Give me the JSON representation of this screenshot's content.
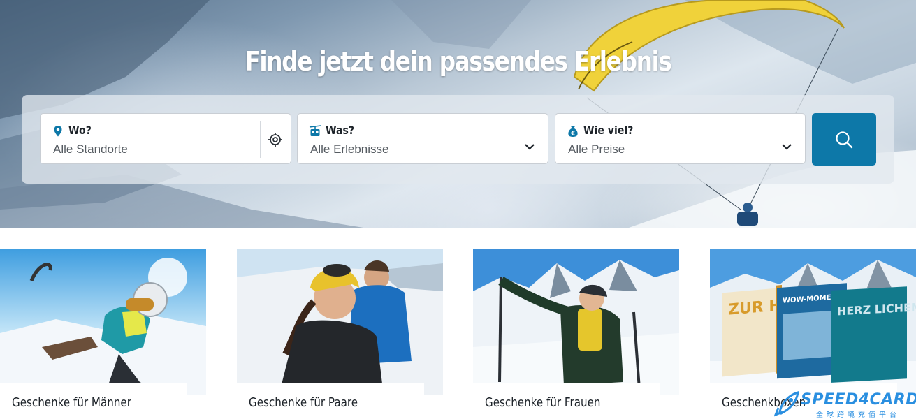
{
  "hero": {
    "title": "Finde jetzt dein passendes Erlebnis"
  },
  "search": {
    "location": {
      "label": "Wo?",
      "value": "Alle Standorte",
      "icon": "map-pin-icon"
    },
    "experience": {
      "label": "Was?",
      "value": "Alle Erlebnisse",
      "icon": "gondola-icon"
    },
    "price": {
      "label": "Wie viel?",
      "value": "Alle Preise",
      "icon": "money-bag-icon"
    },
    "submit_icon": "search-icon"
  },
  "cards": [
    {
      "caption": "Geschenke für Männer"
    },
    {
      "caption": "Geschenke für Paare"
    },
    {
      "caption": "Geschenke für Frauen"
    },
    {
      "caption": "Geschenkboxen"
    }
  ],
  "box_covers": {
    "left": "ZUR HOCH ZEIT",
    "middle": "WOW-MOMENTE",
    "right": "HERZ LICHEN GLÜCK WUNSCH"
  },
  "watermark": {
    "brand": "SPEED4CARD",
    "sub": "全球跨境充值平台"
  },
  "colors": {
    "accent": "#0d78a8",
    "text": "#1d2329",
    "placeholder": "#555b61"
  }
}
